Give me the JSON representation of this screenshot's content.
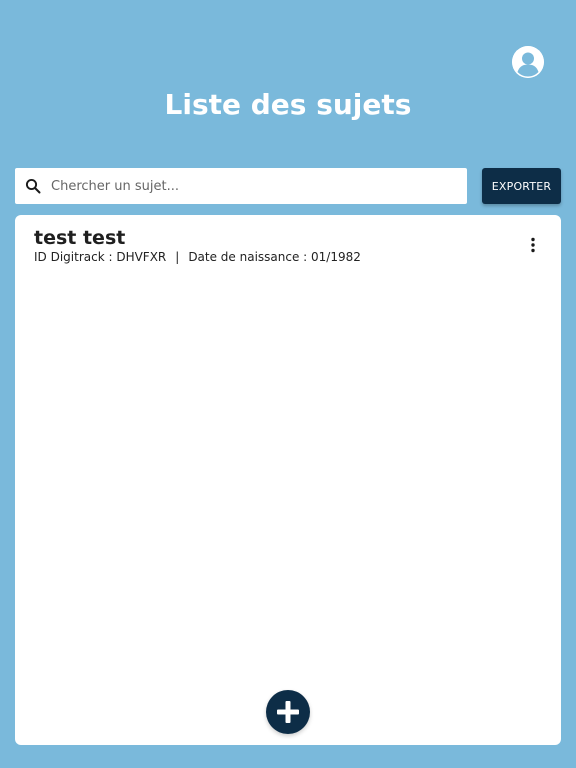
{
  "header": {
    "title": "Liste des sujets",
    "profile_icon": "account-circle-icon"
  },
  "search": {
    "placeholder": "Chercher un sujet...",
    "value": "",
    "icon": "search-icon"
  },
  "toolbar": {
    "export_label": "EXPORTER"
  },
  "subjects": [
    {
      "name": "test test",
      "id_label": "ID Digitrack : DHVFXR",
      "separator": "|",
      "birth_label": "Date de naissance : 01/1982"
    }
  ],
  "actions": {
    "more_icon": "more-vertical-icon",
    "add_icon": "plus-icon"
  },
  "colors": {
    "background": "#7ab9db",
    "primary_dark": "#0d2d47",
    "card": "#ffffff"
  }
}
